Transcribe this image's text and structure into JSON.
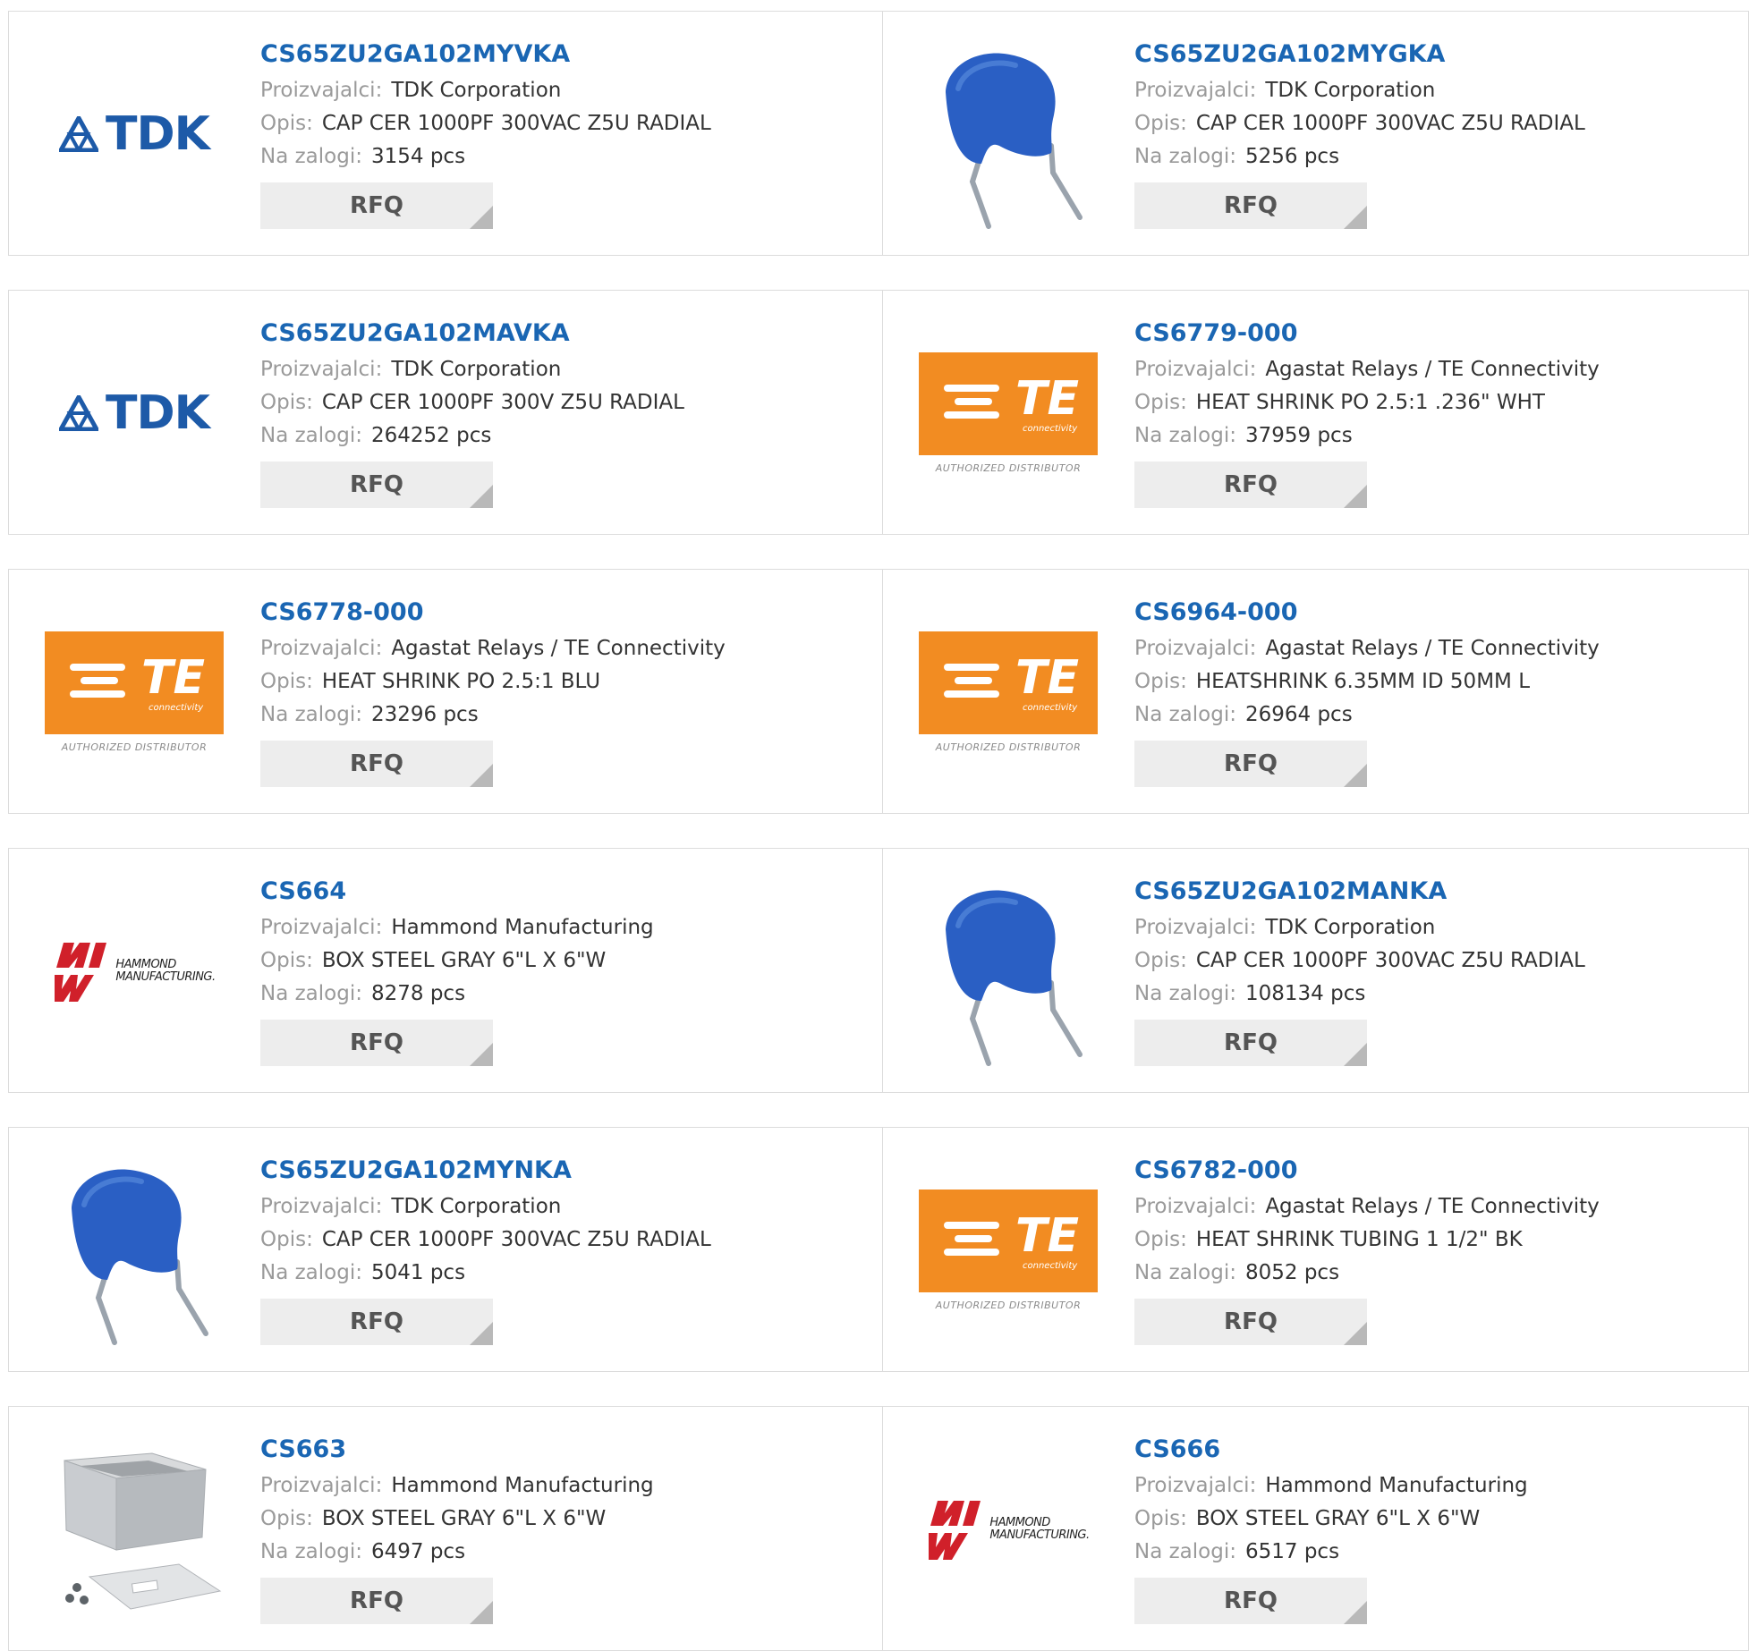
{
  "labels": {
    "manufacturer": "Proizvajalci:",
    "description": "Opis:",
    "stock": "Na zalogi:",
    "rfq": "RFQ"
  },
  "logo_text": {
    "tdk": "TDK",
    "te": "TE",
    "te_sub": "connectivity",
    "te_auth": "AUTHORIZED DISTRIBUTOR",
    "ham_l1": "HAMMOND",
    "ham_l2": "MANUFACTURING."
  },
  "products": [
    {
      "part": "CS65ZU2GA102MYVKA",
      "manufacturer": "TDK Corporation",
      "description": "CAP CER 1000PF 300VAC Z5U RADIAL",
      "stock": "3154 pcs",
      "image": "tdk-logo"
    },
    {
      "part": "CS65ZU2GA102MYGKA",
      "manufacturer": "TDK Corporation",
      "description": "CAP CER 1000PF 300VAC Z5U RADIAL",
      "stock": "5256 pcs",
      "image": "capacitor"
    },
    {
      "part": "CS65ZU2GA102MAVKA",
      "manufacturer": "TDK Corporation",
      "description": "CAP CER 1000PF 300V Z5U RADIAL",
      "stock": "264252 pcs",
      "image": "tdk-logo"
    },
    {
      "part": "CS6779-000",
      "manufacturer": "Agastat Relays / TE Connectivity",
      "description": "HEAT SHRINK PO 2.5:1 .236\" WHT",
      "stock": "37959 pcs",
      "image": "te-logo"
    },
    {
      "part": "CS6778-000",
      "manufacturer": "Agastat Relays / TE Connectivity",
      "description": "HEAT SHRINK PO 2.5:1 BLU",
      "stock": "23296 pcs",
      "image": "te-logo"
    },
    {
      "part": "CS6964-000",
      "manufacturer": "Agastat Relays / TE Connectivity",
      "description": "HEATSHRINK 6.35MM ID 50MM L",
      "stock": "26964 pcs",
      "image": "te-logo"
    },
    {
      "part": "CS664",
      "manufacturer": "Hammond Manufacturing",
      "description": "BOX STEEL GRAY 6\"L X 6\"W",
      "stock": "8278 pcs",
      "image": "hammond-logo"
    },
    {
      "part": "CS65ZU2GA102MANKA",
      "manufacturer": "TDK Corporation",
      "description": "CAP CER 1000PF 300VAC Z5U RADIAL",
      "stock": "108134 pcs",
      "image": "capacitor"
    },
    {
      "part": "CS65ZU2GA102MYNKA",
      "manufacturer": "TDK Corporation",
      "description": "CAP CER 1000PF 300VAC Z5U RADIAL",
      "stock": "5041 pcs",
      "image": "capacitor"
    },
    {
      "part": "CS6782-000",
      "manufacturer": "Agastat Relays / TE Connectivity",
      "description": "HEAT SHRINK TUBING 1 1/2\" BK",
      "stock": "8052 pcs",
      "image": "te-logo"
    },
    {
      "part": "CS663",
      "manufacturer": "Hammond Manufacturing",
      "description": "BOX STEEL GRAY 6\"L X 6\"W",
      "stock": "6497 pcs",
      "image": "steel-box"
    },
    {
      "part": "CS666",
      "manufacturer": "Hammond Manufacturing",
      "description": "BOX STEEL GRAY 6\"L X 6\"W",
      "stock": "6517 pcs",
      "image": "hammond-logo"
    }
  ],
  "colors": {
    "link": "#1a66b3",
    "te_orange": "#f28c22",
    "tdk_blue": "#1d5aa8",
    "hammond_red": "#d0202a",
    "capacitor_blue": "#2a5fc4"
  }
}
